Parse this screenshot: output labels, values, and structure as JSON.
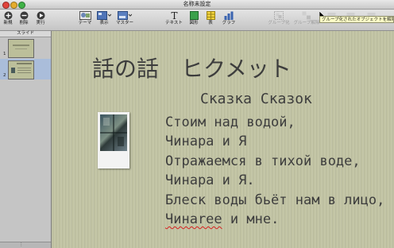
{
  "window": {
    "title": "名称未設定"
  },
  "toolbar": {
    "new_label": "新規",
    "delete_label": "削除",
    "play_label": "実行",
    "theme_label": "テーマ",
    "view_label": "表示",
    "master_label": "マスター",
    "text_label": "テキスト",
    "shape_label": "図形",
    "table_label": "表",
    "chart_label": "グラフ",
    "group_label": "グループ化",
    "ungroup_label": "グループ解除",
    "tooltip": "グループ化されたオブジェクトを解除"
  },
  "sidebar": {
    "header": "スライド",
    "slides": [
      {
        "number": "1",
        "selected": false
      },
      {
        "number": "2",
        "selected": true
      }
    ]
  },
  "slide": {
    "title": "話の話　ヒクメット",
    "subtitle": "Сказка Сказок",
    "body": [
      "Стоим над водой,",
      "Чинара и Я",
      "Отражаемся в тихой воде,",
      "Чинара и Я.",
      "Блеск воды бьёт нам в лицо,"
    ],
    "last_line_misspelled": "Чинаree",
    "last_line_rest": " и мне."
  },
  "colors": {
    "canvas": "#c2c4a4",
    "text": "#3d3d3d",
    "selection": "#aabdda",
    "tooltip": "#ffffc7"
  }
}
